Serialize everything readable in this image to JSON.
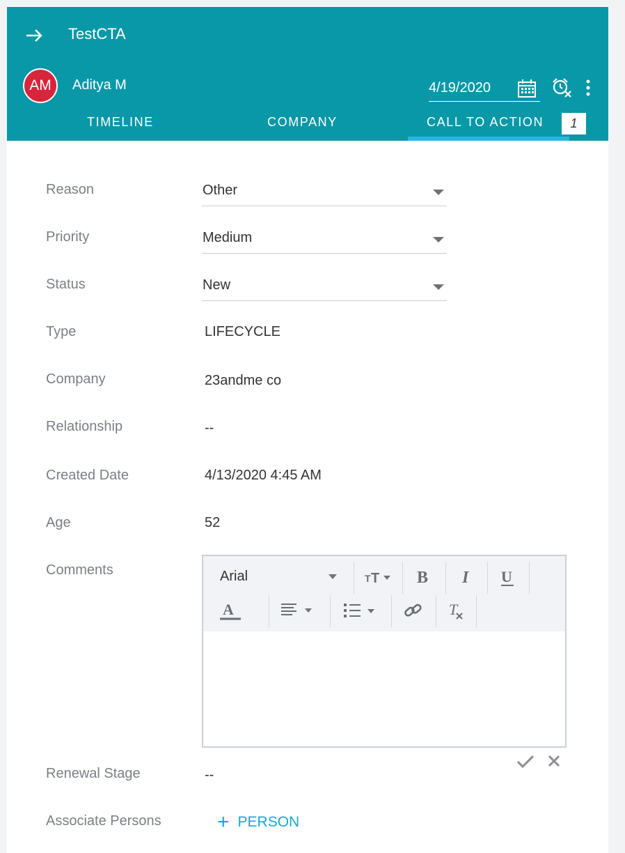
{
  "header": {
    "title": "TestCTA",
    "owner_initials": "AM",
    "owner_name": "Aditya M",
    "due_date": "4/19/2020",
    "tabs": [
      {
        "label": "TIMELINE"
      },
      {
        "label": "COMPANY"
      },
      {
        "label": "CALL TO ACTION",
        "badge": "1",
        "active": true
      }
    ],
    "colors": {
      "header_bg": "#0898a8",
      "avatar_bg": "#d8253c",
      "active_tab_underline": "#21b8e6"
    }
  },
  "form": {
    "reason": {
      "label": "Reason",
      "value": "Other"
    },
    "priority": {
      "label": "Priority",
      "value": "Medium"
    },
    "status": {
      "label": "Status",
      "value": "New"
    },
    "type": {
      "label": "Type",
      "value": "LIFECYCLE"
    },
    "company": {
      "label": "Company",
      "value": "23andme co"
    },
    "relationship": {
      "label": "Relationship",
      "value": "--"
    },
    "created_date": {
      "label": "Created Date",
      "value": "4/13/2020 4:45 AM"
    },
    "age": {
      "label": "Age",
      "value": "52"
    },
    "comments": {
      "label": "Comments",
      "font": "Arial",
      "value": ""
    },
    "renewal_stage": {
      "label": "Renewal Stage",
      "value": "--"
    },
    "associate_persons": {
      "label": "Associate Persons",
      "action": "PERSON"
    }
  },
  "icons": [
    "arrow-right-icon",
    "calendar-icon",
    "snooze-alarm-icon",
    "more-vertical-icon",
    "font-size-icon",
    "bold-icon",
    "italic-icon",
    "underline-icon",
    "text-color-icon",
    "align-icon",
    "list-icon",
    "link-icon",
    "clear-format-icon",
    "check-icon",
    "close-icon",
    "plus-icon"
  ],
  "accent_color": "#1ca6d8"
}
